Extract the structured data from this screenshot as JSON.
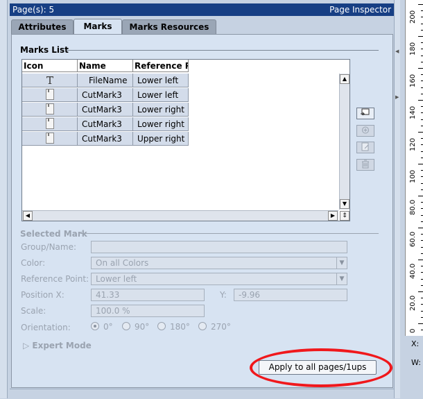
{
  "header": {
    "pages_label": "Page(s): 5",
    "title": "Page Inspector"
  },
  "tabs": [
    {
      "label": "Attributes",
      "active": false
    },
    {
      "label": "Marks",
      "active": true
    },
    {
      "label": "Marks Resources",
      "active": false
    }
  ],
  "marks_list": {
    "title": "Marks List",
    "columns": [
      "Icon",
      "Name",
      "Reference Po"
    ],
    "rows": [
      {
        "icon": "text-icon",
        "name": "FileName",
        "reference": "Lower left"
      },
      {
        "icon": "cut-mark-icon",
        "name": "CutMark3",
        "reference": "Lower left"
      },
      {
        "icon": "cut-mark-icon",
        "name": "CutMark3",
        "reference": "Lower right"
      },
      {
        "icon": "cut-mark-icon",
        "name": "CutMark3",
        "reference": "Lower right"
      },
      {
        "icon": "cut-mark-icon",
        "name": "CutMark3",
        "reference": "Upper right"
      }
    ]
  },
  "side_buttons": [
    {
      "icon": "add-mark-icon",
      "enabled": true
    },
    {
      "icon": "duplicate-mark-icon",
      "enabled": false
    },
    {
      "icon": "edit-mark-icon",
      "enabled": false
    },
    {
      "icon": "trash-icon",
      "enabled": false
    }
  ],
  "selected_mark": {
    "title": "Selected Mark",
    "group_name_label": "Group/Name:",
    "group_name_value": "",
    "color_label": "Color:",
    "color_value": "On all Colors",
    "reference_point_label": "Reference Point:",
    "reference_point_value": "Lower left",
    "position_x_label": "Position X:",
    "position_x_value": "41.33",
    "y_label": "Y:",
    "y_value": "-9.96",
    "scale_label": "Scale:",
    "scale_value": "100.0 %",
    "orientation_label": "Orientation:",
    "orientation_options": [
      "0°",
      "90°",
      "180°",
      "270°"
    ],
    "orientation_selected": "0°",
    "expert_mode_label": "Expert Mode"
  },
  "apply_button_label": "Apply to all pages/1ups",
  "ruler": {
    "labels": [
      "200",
      "180",
      "160",
      "140",
      "120",
      "100",
      "80.0",
      "60.0",
      "40.0",
      "20.0",
      "0"
    ]
  },
  "coords": {
    "x_label": "X:",
    "w_label": "W:"
  },
  "colors": {
    "title_bar": "#173f84",
    "highlight": "#f0181c",
    "panel": "#d7e3f2"
  }
}
